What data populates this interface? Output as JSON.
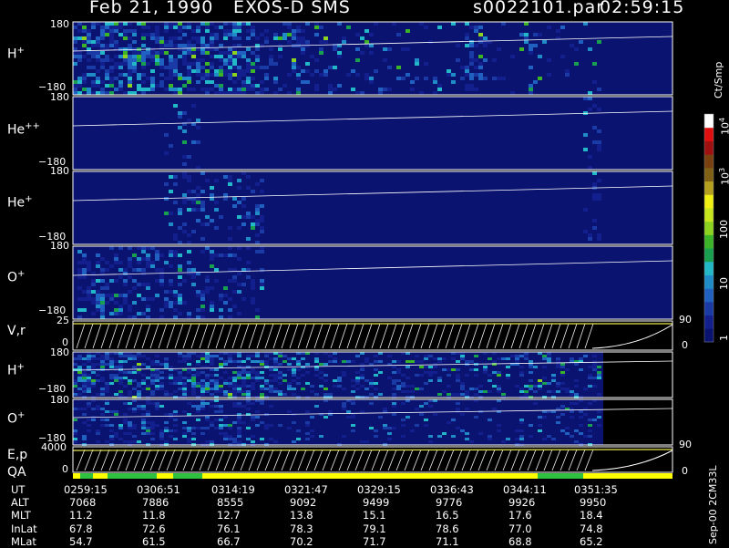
{
  "header": {
    "date": "Feb 21, 1990",
    "instrument": "EXOS-D SMS",
    "file": "s0022101.par",
    "time": "02:59:15"
  },
  "footer_note": "Sep-00 2CM33L",
  "chart_data": {
    "type": "heatmap",
    "colorbar": {
      "title": "Ct/Smp",
      "scale": "log",
      "tick_labels": [
        "1",
        "10",
        "100",
        "10",
        "10"
      ],
      "tick_exponents": [
        "",
        "",
        "",
        "3",
        "4"
      ],
      "tick_values": [
        1,
        10,
        100,
        1000,
        10000
      ],
      "colors": [
        "#0a1370",
        "#121f8c",
        "#1a3aa6",
        "#1f60c0",
        "#1f8cc8",
        "#22b8c8",
        "#18a050",
        "#3cb428",
        "#8cd21e",
        "#c8e61e",
        "#f0f014",
        "#b4a01e",
        "#806014",
        "#7a4010",
        "#a01010",
        "#e01010",
        "#ffffff"
      ]
    },
    "panels": [
      {
        "label": "H",
        "sup": "+",
        "ymax": "180",
        "ymin": "−180"
      },
      {
        "label": "He",
        "sup": "++",
        "ymax": "180",
        "ymin": "−180"
      },
      {
        "label": "He",
        "sup": "+",
        "ymax": "180",
        "ymin": "−180"
      },
      {
        "label": "O",
        "sup": "+",
        "ymax": "180",
        "ymin": "−180"
      },
      {
        "label": "V,r",
        "sup": "",
        "ymax": "25",
        "ymin": "0",
        "right_max": "90",
        "right_min": "0"
      },
      {
        "label": "H",
        "sup": "+",
        "ymax": "180",
        "ymin": "−180"
      },
      {
        "label": "O",
        "sup": "+",
        "ymax": "180",
        "ymin": "−180"
      },
      {
        "label": "E,p",
        "sup": "",
        "ymax": "4000",
        "ymin": "0",
        "right_max": "90",
        "right_min": "0"
      }
    ],
    "qa_label": "QA",
    "orbit_table": {
      "rows": [
        {
          "name": "UT",
          "values": [
            "0259:15",
            "0306:51",
            "0314:19",
            "0321:47",
            "0329:15",
            "0336:43",
            "0344:11",
            "0351:35"
          ]
        },
        {
          "name": "ALT",
          "values": [
            "7068",
            "7886",
            "8555",
            "9092",
            "9499",
            "9776",
            "9926",
            "9950"
          ]
        },
        {
          "name": "MLT",
          "values": [
            "11.2",
            "11.8",
            "12.7",
            "13.8",
            "15.1",
            "16.5",
            "17.6",
            "18.4"
          ]
        },
        {
          "name": "InLat",
          "values": [
            "67.8",
            "72.6",
            "76.1",
            "78.3",
            "79.1",
            "78.6",
            "77.0",
            "74.8"
          ]
        },
        {
          "name": "MLat",
          "values": [
            "54.7",
            "61.5",
            "66.7",
            "70.2",
            "71.7",
            "71.1",
            "68.8",
            "65.2"
          ]
        }
      ]
    }
  }
}
